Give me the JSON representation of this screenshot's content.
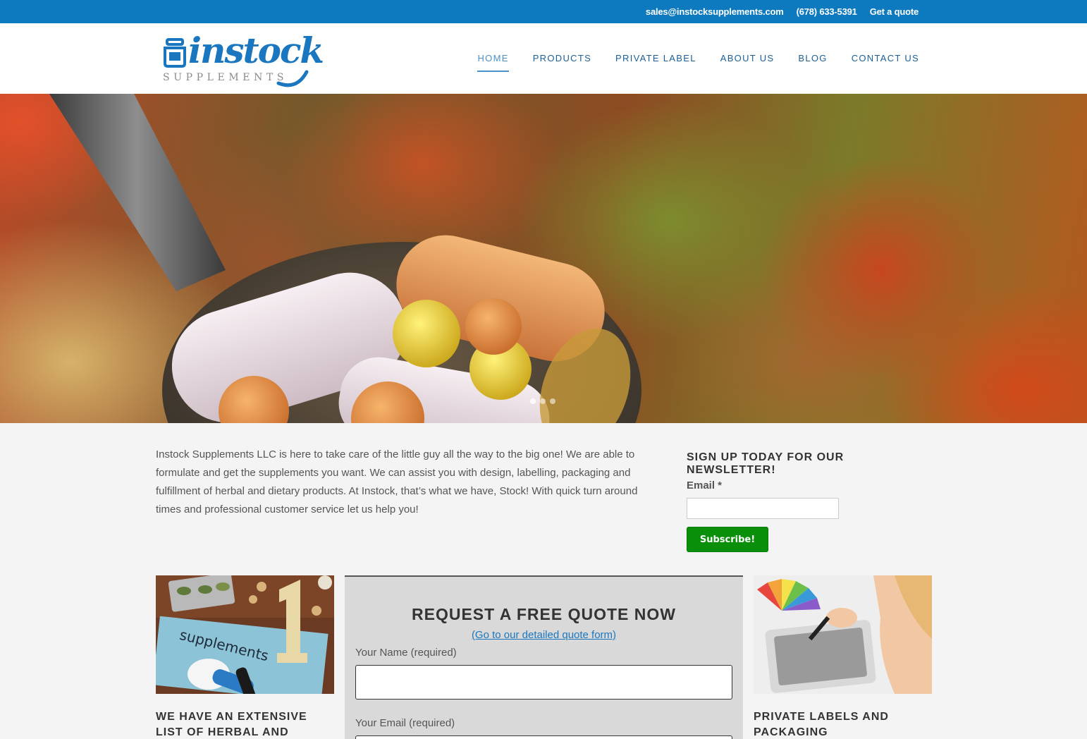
{
  "topbar": {
    "email": "sales@instocksupplements.com",
    "phone": "(678) 633-5391",
    "quote_link": "Get a quote"
  },
  "brand": {
    "wordmark": "instock",
    "tagline": "SUPPLEMENTS",
    "color": "#1a77bf"
  },
  "nav": {
    "items": [
      {
        "label": "HOME",
        "active": true
      },
      {
        "label": "PRODUCTS"
      },
      {
        "label": "PRIVATE LABEL"
      },
      {
        "label": "ABOUT US"
      },
      {
        "label": "BLOG"
      },
      {
        "label": "CONTACT US"
      }
    ]
  },
  "hero": {
    "slide_count": 3,
    "active_slide": 1
  },
  "intro": {
    "text": "Instock Supplements LLC is here to take care of the little guy all the way to the big one! We are able to formulate and get the supplements you want. We can assist you with design, labelling, packaging and fulfillment of herbal and dietary products. At Instock, that’s what we have, Stock! With quick turn around times and professional customer service let us help you!"
  },
  "newsletter": {
    "heading": "SIGN UP TODAY FOR OUR NEWSLETTER!",
    "email_label": "Email *",
    "email_value": "",
    "button": "Subscribe!",
    "button_color": "#0a8f0a"
  },
  "cards": {
    "left_title": "WE HAVE AN EXTENSIVE LIST OF HERBAL AND DIETARY",
    "left_image_text": "supplements",
    "right_title": "PRIVATE LABELS AND PACKAGING"
  },
  "quote": {
    "heading": "REQUEST A FREE QUOTE NOW",
    "detail_link": "(Go to our detailed quote form)",
    "name_label": "Your Name (required)",
    "name_value": "",
    "email_label": "Your Email (required)",
    "email_value": ""
  },
  "icons": {
    "slide_dot": "slide-dot-icon",
    "logo_jar": "supplement-jar-icon"
  }
}
